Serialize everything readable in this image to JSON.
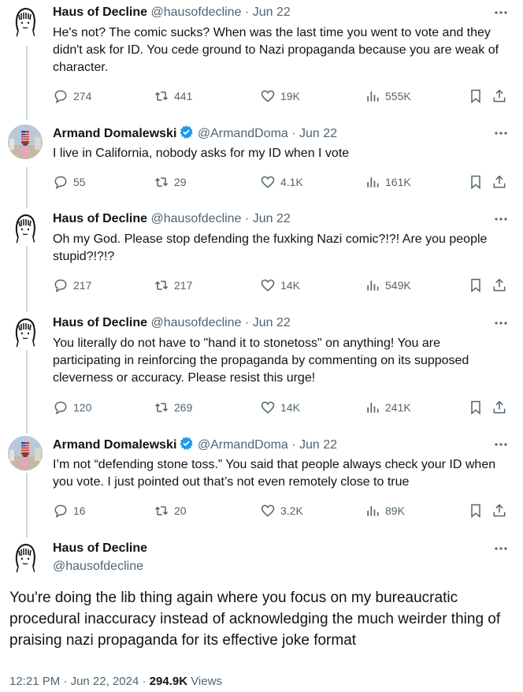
{
  "tweets": [
    {
      "name": "Haus of Decline",
      "handle": "@hausofdecline",
      "date": "Jun 22",
      "verified": false,
      "text": "He's not? The comic sucks? When was the last time you went to vote and they didn't ask for ID. You cede ground to Nazi propaganda because you are weak of character.",
      "replies": "274",
      "reposts": "441",
      "likes": "19K",
      "views": "555K"
    },
    {
      "name": "Armand Domalewski",
      "handle": "@ArmandDoma",
      "date": "Jun 22",
      "verified": true,
      "text": "I live in California, nobody asks for my ID when I vote",
      "replies": "55",
      "reposts": "29",
      "likes": "4.1K",
      "views": "161K"
    },
    {
      "name": "Haus of Decline",
      "handle": "@hausofdecline",
      "date": "Jun 22",
      "verified": false,
      "text": "Oh my God. Please stop defending the fuxking Nazi comic?!?! Are you people stupid?!?!?",
      "replies": "217",
      "reposts": "217",
      "likes": "14K",
      "views": "549K"
    },
    {
      "name": "Haus of Decline",
      "handle": "@hausofdecline",
      "date": "Jun 22",
      "verified": false,
      "text": "You literally do not have to \"hand it to stonetoss\" on anything! You are participating in reinforcing the propaganda by commenting on its supposed cleverness or accuracy. Please resist this urge!",
      "replies": "120",
      "reposts": "269",
      "likes": "14K",
      "views": "241K"
    },
    {
      "name": "Armand Domalewski",
      "handle": "@ArmandDoma",
      "date": "Jun 22",
      "verified": true,
      "text": "I’m not “defending stone toss.” You said that people always check your ID when you vote. I just pointed out that’s not even remotely close to true",
      "replies": "16",
      "reposts": "20",
      "likes": "3.2K",
      "views": "89K"
    }
  ],
  "main_tweet": {
    "name": "Haus of Decline",
    "handle": "@hausofdecline",
    "text": "You're doing the lib thing again where you focus on my bureaucratic procedural inaccuracy instead of acknowledging the much weirder thing of praising nazi propaganda for its effective joke format",
    "time": "12:21 PM",
    "date": "Jun 22, 2024",
    "views_count": "294.9K",
    "views_label": "Views"
  },
  "separator": "·",
  "icons": {
    "reply": "reply-icon",
    "repost": "repost-icon",
    "like": "heart-icon",
    "views": "views-chart-icon",
    "bookmark": "bookmark-icon",
    "share": "share-icon",
    "more": "more-icon",
    "verified": "verified-badge-icon"
  },
  "colors": {
    "accent": "#1d9bf0",
    "muted": "#536471",
    "text": "#0f1419",
    "line": "#cfd9de"
  }
}
